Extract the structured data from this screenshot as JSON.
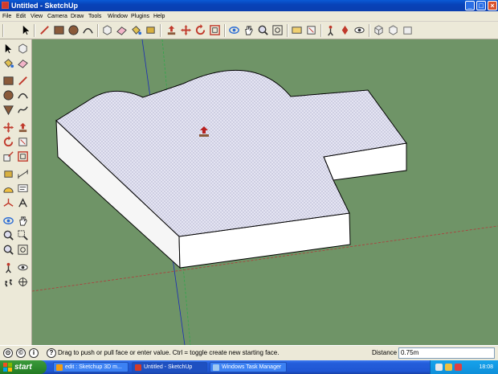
{
  "window": {
    "title": "Untitled - SketchUp",
    "min": "_",
    "max": "□",
    "close": "×"
  },
  "menu": [
    "File",
    "Edit",
    "View",
    "Camera",
    "Draw",
    "Tools",
    "Window",
    "Plugins",
    "Help"
  ],
  "toolbar_icons": [
    "select-icon",
    "line-icon",
    "rectangle-icon",
    "circle-icon",
    "arc-icon",
    "eraser-icon",
    "paint-bucket-icon",
    "make-component-icon",
    "push-pull-icon",
    "move-icon",
    "rotate-icon",
    "offset-icon",
    "orbit-icon",
    "pan-icon",
    "zoom-icon",
    "zoom-extents-icon",
    "section-plane-icon",
    "follow-me-icon",
    "dimension-icon",
    "text-icon",
    "axes-icon",
    "iso-view-icon",
    "top-view-icon",
    "front-view-icon"
  ],
  "status": {
    "help_icon": "?",
    "message": "Drag to push or pull face or enter value.  Ctrl = toggle create new starting face.",
    "distance_label": "Distance",
    "distance_value": "0.75m"
  },
  "taskbar": {
    "start": "start",
    "tasks": [
      "edit : Sketchup 3D m...",
      "Untitled - SketchUp",
      "Windows Task Manager"
    ],
    "clock": "18:08"
  },
  "colors": {
    "viewport_bg": "#6f9467",
    "face_top": "#dcdcf0",
    "face_side": "#ffffff",
    "accent": "#245edb"
  }
}
